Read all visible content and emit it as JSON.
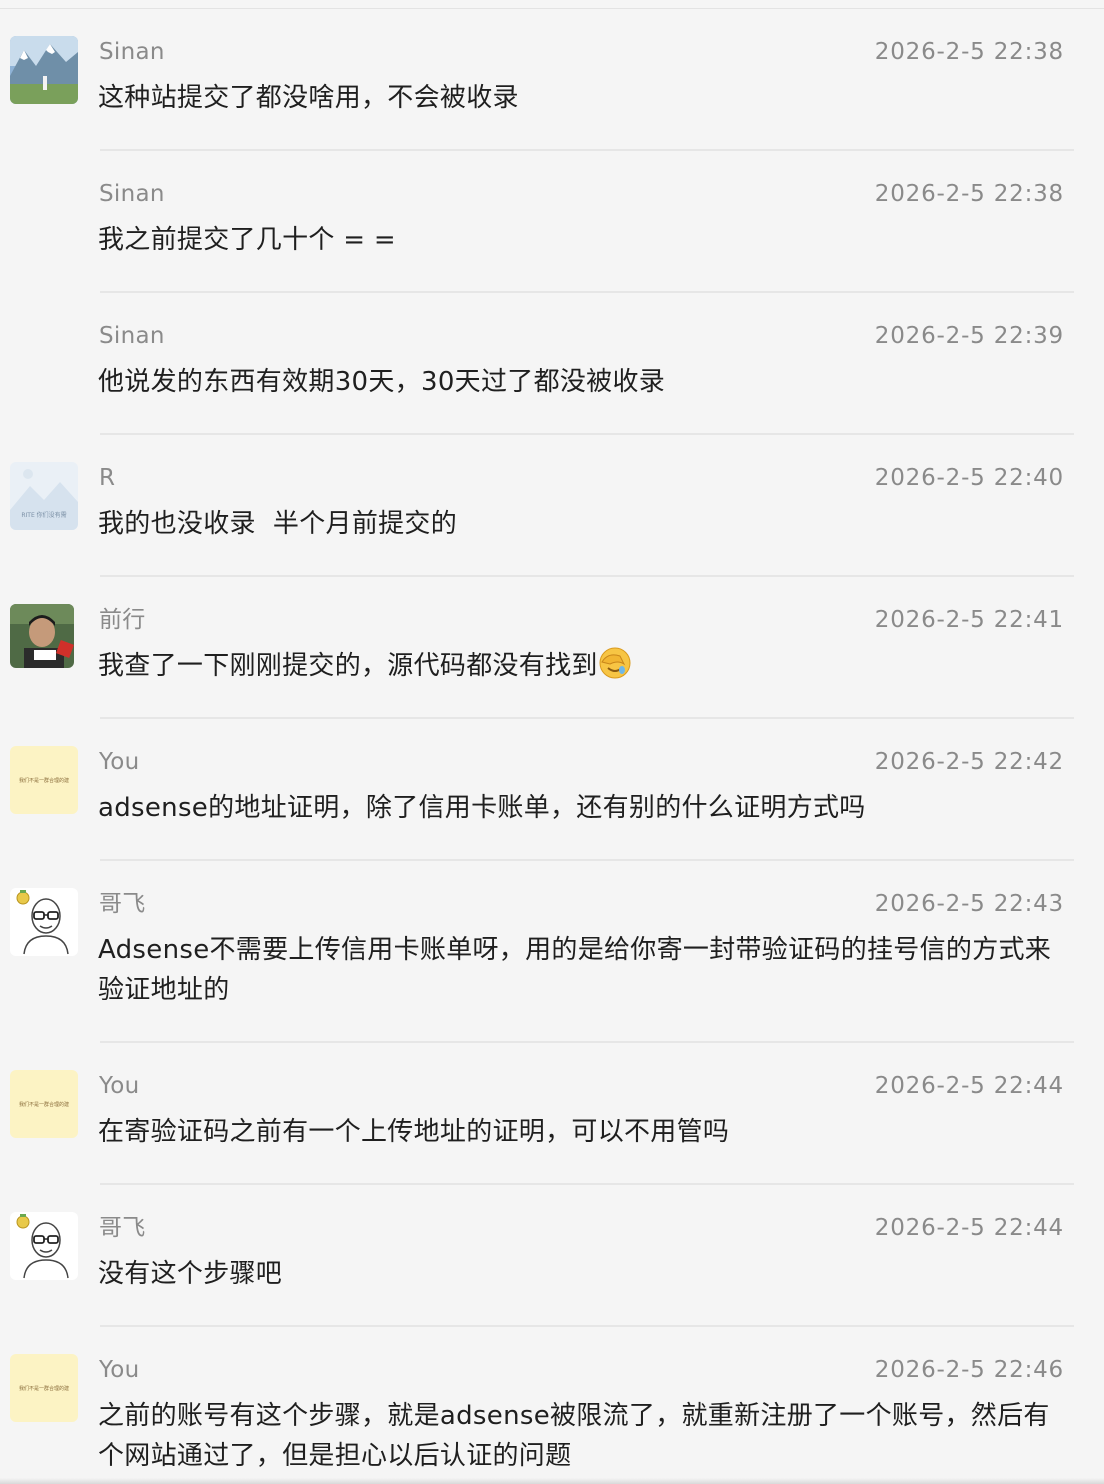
{
  "messages": [
    {
      "sender": "Sinan",
      "time": "2026-2-5 22:38",
      "avatar": "mountain-photo-avatar",
      "text": "这种站提交了都没啥用，不会被收录"
    },
    {
      "sender": "Sinan",
      "time": "2026-2-5 22:38",
      "avatar": null,
      "text": "我之前提交了几十个 = ="
    },
    {
      "sender": "Sinan",
      "time": "2026-2-5 22:39",
      "avatar": null,
      "text": "他说发的东西有效期30天，30天过了都没被收录"
    },
    {
      "sender": "R",
      "time": "2026-2-5 22:40",
      "avatar": "placeholder-landscape-avatar",
      "text": "我的也没收录  半个月前提交的"
    },
    {
      "sender": "前行",
      "time": "2026-2-5 22:41",
      "avatar": "person-photo-avatar",
      "text": "我查了一下刚刚提交的，源代码都没有找到"
    },
    {
      "sender": "You",
      "time": "2026-2-5 22:42",
      "avatar": "yellow-note-avatar",
      "text": "adsense的地址证明，除了信用卡账单，还有别的什么证明方式吗"
    },
    {
      "sender": "哥飞",
      "time": "2026-2-5 22:43",
      "avatar": "cartoon-man-avatar",
      "text": "Adsense不需要上传信用卡账单呀，用的是给你寄一封带验证码的挂号信的方式来验证地址的"
    },
    {
      "sender": "You",
      "time": "2026-2-5 22:44",
      "avatar": "yellow-note-avatar",
      "text": "在寄验证码之前有一个上传地址的证明，可以不用管吗"
    },
    {
      "sender": "哥飞",
      "time": "2026-2-5 22:44",
      "avatar": "cartoon-man-avatar",
      "text": "没有这个步骤吧"
    },
    {
      "sender": "You",
      "time": "2026-2-5 22:46",
      "avatar": "yellow-note-avatar",
      "text": "之前的账号有这个步骤，就是adsense被限流了，就重新注册了一个账号，然后有个网站通过了，但是担心以后认证的问题"
    }
  ],
  "emoji": {
    "name": "facepalm-emoji"
  },
  "avatar_texts": {
    "placeholder": "RITE 你们没有需",
    "yellow_note": "我们不是一群合理的建"
  },
  "colors": {
    "background": "#f5f5f5",
    "meta_text": "#8a8a8a",
    "body_text": "#1f1f1f",
    "divider": "#e6e6e6",
    "note_yellow": "#fcf3c4"
  }
}
